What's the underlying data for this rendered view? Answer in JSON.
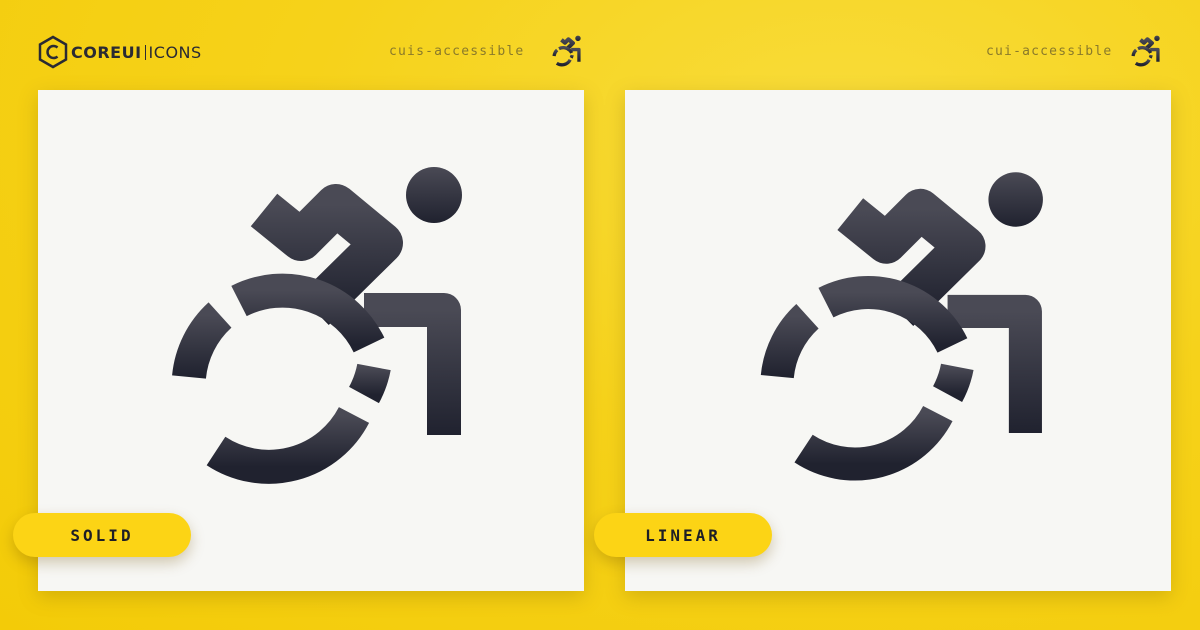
{
  "brand": {
    "name_core": "COREUI",
    "name_icons": "ICONS"
  },
  "colors": {
    "background": "#f6d21a",
    "card": "#f7f7f4",
    "icon": "#2b2c38",
    "pill": "#fcd415"
  },
  "panels": [
    {
      "icon_name": "cuis-accessible",
      "label": "SOLID",
      "icon": "accessible-icon"
    },
    {
      "icon_name": "cui-accessible",
      "label": "LINEAR",
      "icon": "accessible-icon"
    }
  ]
}
